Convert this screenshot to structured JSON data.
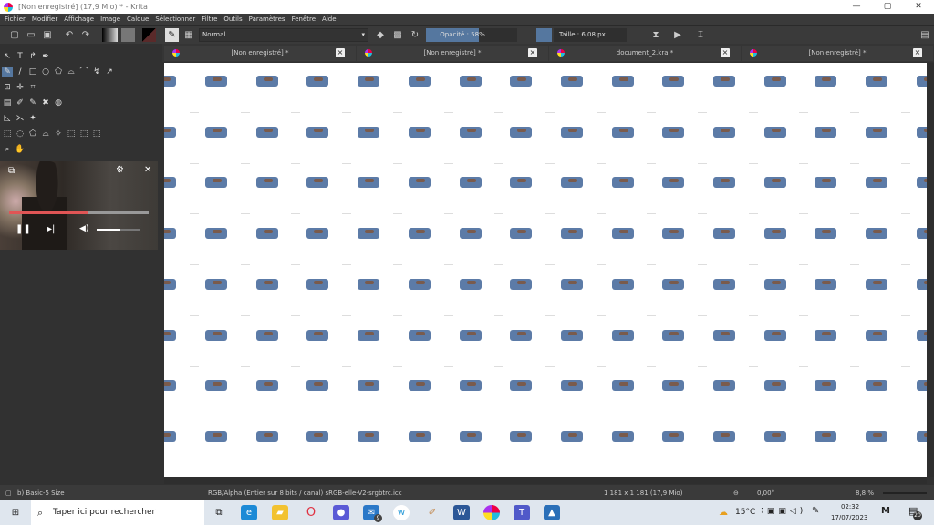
{
  "window": {
    "title": "[Non enregistré]  (17,9 Mio)  * - Krita",
    "minimize": "—",
    "maximize": "▢",
    "close": "✕"
  },
  "menu": [
    "Fichier",
    "Modifier",
    "Affichage",
    "Image",
    "Calque",
    "Sélectionner",
    "Filtre",
    "Outils",
    "Paramètres",
    "Fenêtre",
    "Aide"
  ],
  "toolbar": {
    "blend_mode": "Normal",
    "opacity_label": "Opacité : 58%",
    "opacity_value": 58,
    "size_label": "Taille :  6,08 px",
    "brush_color": "#55779f"
  },
  "tabs": [
    {
      "label": "[Non enregistré]  *"
    },
    {
      "label": "[Non enregistré]  *"
    },
    {
      "label": "document_2.kra *"
    },
    {
      "label": "[Non enregistré]  *"
    }
  ],
  "player": {
    "progress_percent": 56,
    "volume_percent": 55,
    "accent": "#e05555"
  },
  "status": {
    "brush": "b) Basic-5 Size",
    "color_info": "RGB/Alpha (Entier sur 8 bits / canal)  sRGB-elle-V2-srgbtrc.icc",
    "dimensions": "1 181 x 1 181 (17,9 Mio)",
    "rotation": "0,00°",
    "zoom": "8,8 %"
  },
  "taskbar": {
    "search_placeholder": "Taper ici pour rechercher",
    "weather": "15°C",
    "time": "02:32",
    "date": "17/07/2023",
    "notifications": "20",
    "mail_badge": "9"
  }
}
